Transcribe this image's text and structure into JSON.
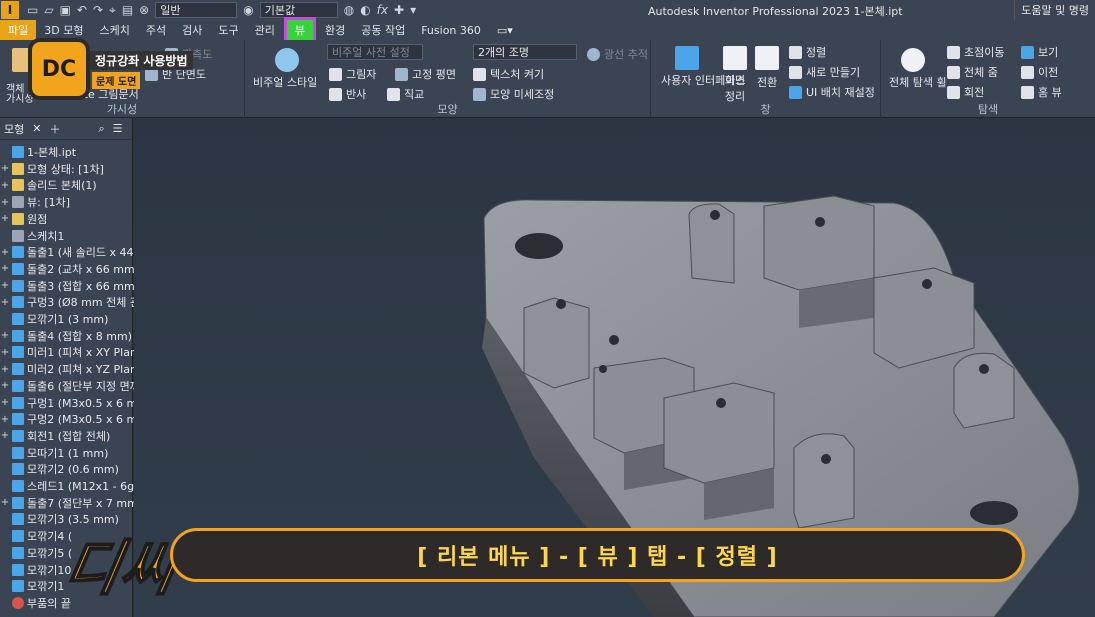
{
  "window": {
    "title": "Autodesk Inventor Professional 2023    1-본체.ipt",
    "app_icon": "I",
    "appearance_combo": "일반",
    "material_combo": "기본값",
    "help": "도움말 및 명령"
  },
  "tabs": [
    {
      "label": "파일"
    },
    {
      "label": "3D 모형"
    },
    {
      "label": "스케치"
    },
    {
      "label": "주석"
    },
    {
      "label": "검사"
    },
    {
      "label": "도구"
    },
    {
      "label": "관리"
    },
    {
      "label": "뷰"
    },
    {
      "label": "환경"
    },
    {
      "label": "공동 작업"
    },
    {
      "label": "Fusion 360"
    }
  ],
  "ribbon": {
    "visibility": {
      "label": "가시성",
      "items": [
        "객체",
        "가시성",
        "date 그림문서",
        "관측도",
        "반 단면도"
      ]
    },
    "appearance": {
      "label": "모양",
      "visual_style": "비주얼 스타일",
      "visual_style_preset": "비주얼 사전 설정",
      "shadows": "그림자",
      "ground_plane": "고정 평면",
      "textures": "텍스처 켜기",
      "reflections": "반사",
      "orthographic": "직교",
      "lighting": "2개의 조명",
      "ray_tracing": "광선 추적",
      "appearance_tuning": "모양 미세조정"
    },
    "windows": {
      "label": "창",
      "user_interface": "사용자 인터페이스",
      "clean_screen": "화면 정리",
      "switch": "전환",
      "arrange": "정렬",
      "new_window": "새로 만들기",
      "reset_ui": "UI 배치 재설정"
    },
    "navigate": {
      "label": "탐색",
      "full_navwheel": "전체 탐색 휠",
      "pan": "초점이동",
      "zoom_all": "전체 줌",
      "orbit": "회전",
      "look_at": "보기",
      "previous": "이전",
      "home_view": "홈 뷰"
    }
  },
  "browser": {
    "tab": "모형",
    "items": [
      {
        "label": "1-본체.ipt",
        "icon": "part"
      },
      {
        "label": "모형 상태: [1차]",
        "icon": "folder"
      },
      {
        "label": "솔리드 본체(1)",
        "icon": "folder"
      },
      {
        "label": "뷰: [1차]",
        "icon": "view"
      },
      {
        "label": "원점",
        "icon": "folder"
      },
      {
        "label": "스케치1",
        "icon": "sketch"
      },
      {
        "label": "돌출1 (새 솔리드 x 44 r",
        "icon": "feature"
      },
      {
        "label": "돌출2 (교차 x 66 mm)",
        "icon": "feature"
      },
      {
        "label": "돌출3 (접합 x 66 mm)",
        "icon": "feature"
      },
      {
        "label": "구멍3 (Ø8 mm 전체 관",
        "icon": "feature"
      },
      {
        "label": "모깎기1 (3 mm)",
        "icon": "feature"
      },
      {
        "label": "돌출4 (접합 x 8 mm)",
        "icon": "feature"
      },
      {
        "label": "미러1 (피쳐 x XY Plan",
        "icon": "feature"
      },
      {
        "label": "미러2 (피쳐 x YZ Plane",
        "icon": "feature"
      },
      {
        "label": "돌출6 (절단부 지정 면까",
        "icon": "feature"
      },
      {
        "label": "구멍1 (M3x0.5 x 6 m",
        "icon": "feature"
      },
      {
        "label": "구멍2 (M3x0.5 x 6 m",
        "icon": "feature"
      },
      {
        "label": "회전1 (접합 전체)",
        "icon": "feature"
      },
      {
        "label": "모따기1 (1 mm)",
        "icon": "feature"
      },
      {
        "label": "모깎기2 (0.6 mm)",
        "icon": "feature"
      },
      {
        "label": "스레드1 (M12x1 - 6g)",
        "icon": "feature"
      },
      {
        "label": "돌출7 (절단부 x 7 mm)",
        "icon": "feature"
      },
      {
        "label": "모깎기3 (3.5 mm)",
        "icon": "feature"
      },
      {
        "label": "모깎기4 (",
        "icon": "feature"
      },
      {
        "label": "모깎기5 (",
        "icon": "feature"
      },
      {
        "label": "모깎기10",
        "icon": "feature"
      },
      {
        "label": "모깎기1",
        "icon": "feature"
      },
      {
        "label": "부품의 끝",
        "icon": "end"
      }
    ]
  },
  "overlay": {
    "logo": "DC",
    "course_title": "정규강좌 사용방법",
    "course_sub": "문제 도면",
    "brand_big": "디씨",
    "caption": "[ 리본 메뉴 ] - [ 뷰 ] 탭 - [ 정렬 ]"
  }
}
